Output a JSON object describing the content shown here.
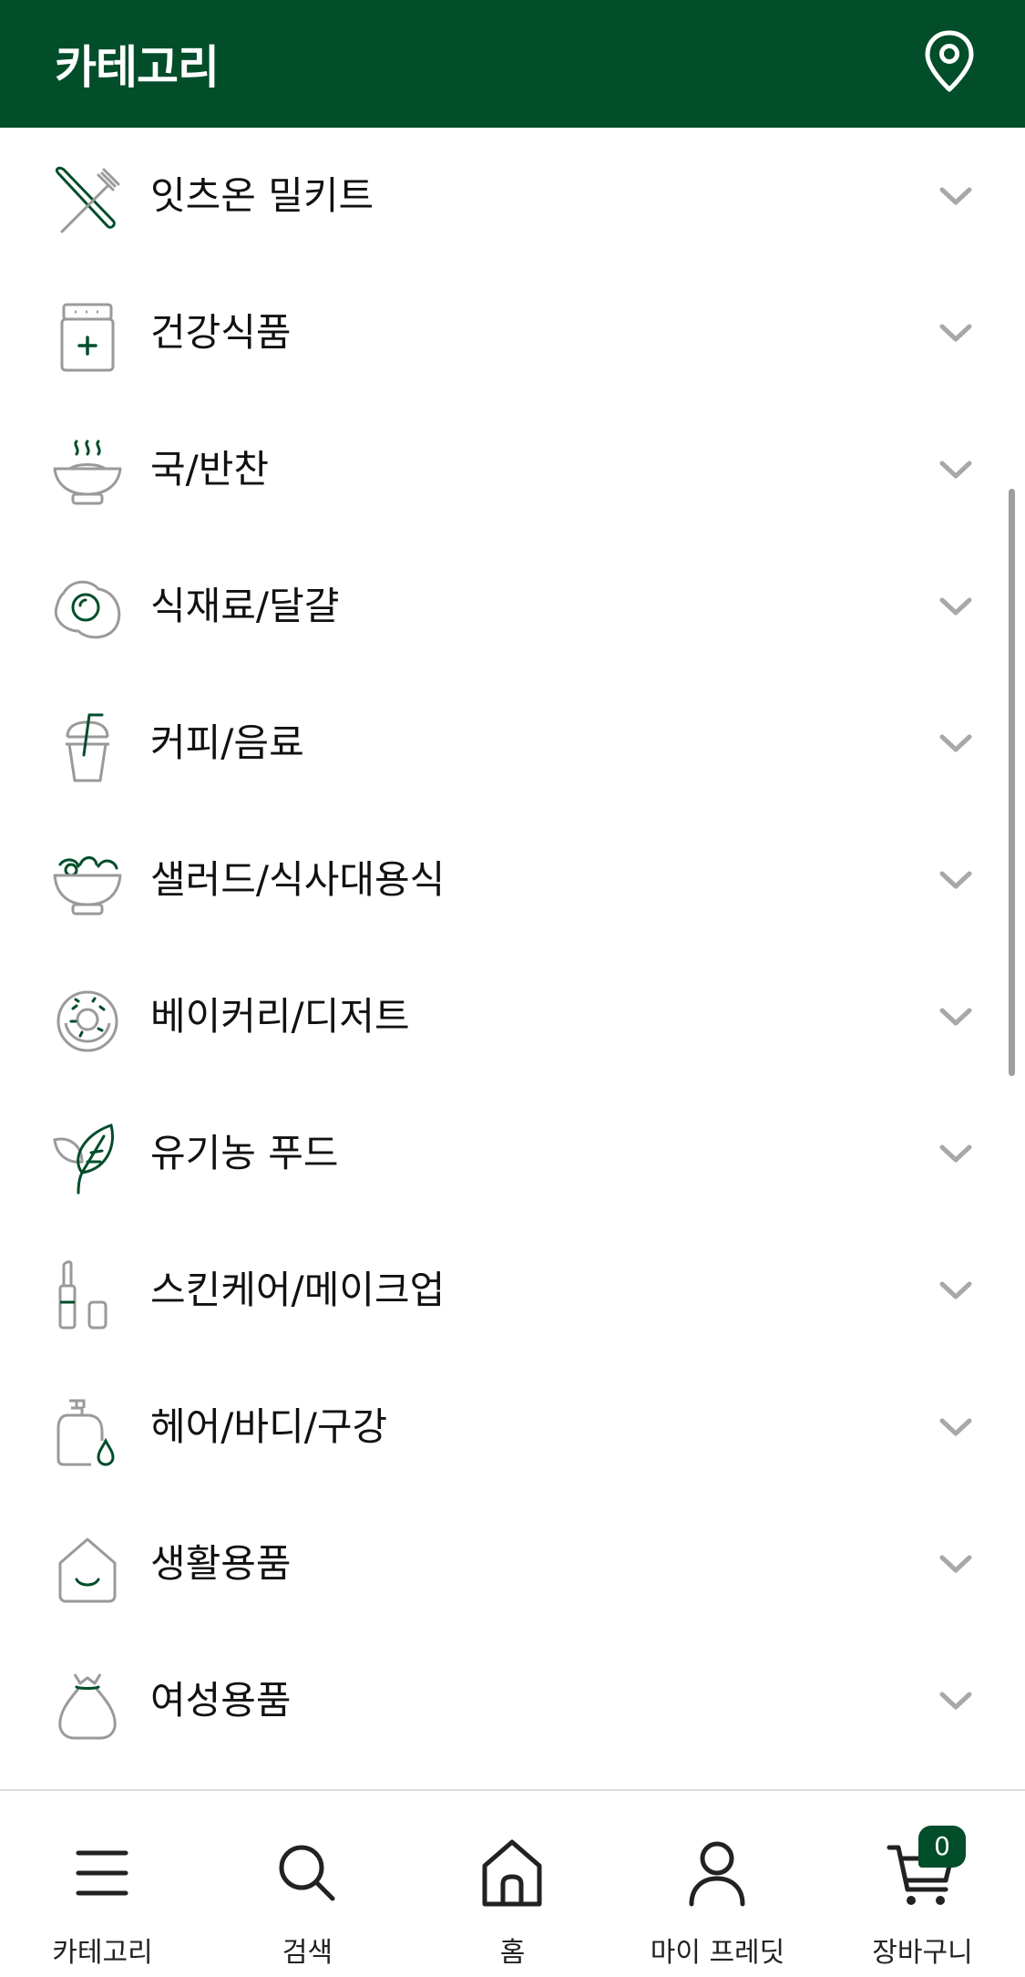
{
  "header": {
    "title": "카테고리",
    "location_icon": "location-pin-icon"
  },
  "categories": [
    {
      "label": "잇츠온 밀키트",
      "icon": "fork-knife-icon"
    },
    {
      "label": "건강식품",
      "icon": "supplement-jar-icon"
    },
    {
      "label": "국/반찬",
      "icon": "hot-soup-bowl-icon"
    },
    {
      "label": "식재료/달걀",
      "icon": "fried-egg-icon"
    },
    {
      "label": "커피/음료",
      "icon": "drink-cup-icon"
    },
    {
      "label": "샐러드/식사대용식",
      "icon": "salad-bowl-icon"
    },
    {
      "label": "베이커리/디저트",
      "icon": "donut-icon"
    },
    {
      "label": "유기농 푸드",
      "icon": "leaf-icon"
    },
    {
      "label": "스킨케어/메이크업",
      "icon": "lipstick-icon"
    },
    {
      "label": "헤어/바디/구강",
      "icon": "pump-bottle-icon"
    },
    {
      "label": "생활용품",
      "icon": "home-smile-icon"
    },
    {
      "label": "여성용품",
      "icon": "pouch-icon"
    }
  ],
  "tabbar": {
    "tabs": [
      {
        "label": "카테고리",
        "icon": "menu-icon"
      },
      {
        "label": "검색",
        "icon": "search-icon"
      },
      {
        "label": "홈",
        "icon": "home-icon"
      },
      {
        "label": "마이 프레딧",
        "icon": "user-icon"
      },
      {
        "label": "장바구니",
        "icon": "cart-icon"
      }
    ],
    "cart_count": "0"
  },
  "colors": {
    "brand": "#024D2A",
    "chevron": "#a8a8a8",
    "icon_gray": "#9a9a9a"
  }
}
